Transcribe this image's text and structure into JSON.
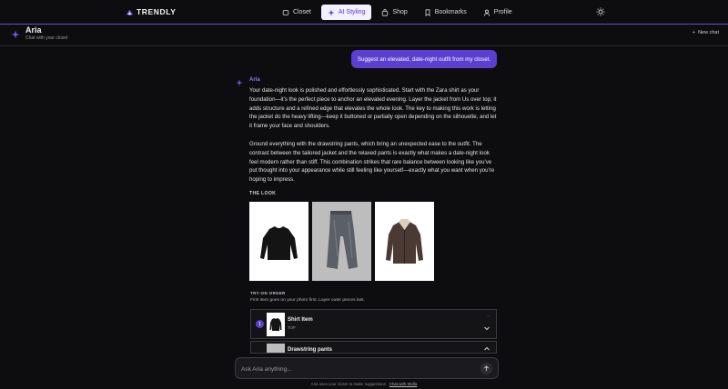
{
  "app": {
    "brand": "TRENDLY"
  },
  "nav": {
    "items": [
      {
        "label": "Closet",
        "icon": "hanger-icon",
        "active": false
      },
      {
        "label": "AI Styling",
        "icon": "sparkle-icon",
        "active": true
      },
      {
        "label": "Shop",
        "icon": "bag-icon",
        "active": false
      },
      {
        "label": "Bookmarks",
        "icon": "bookmark-icon",
        "active": false
      },
      {
        "label": "Profile",
        "icon": "user-icon",
        "active": false
      }
    ]
  },
  "chat": {
    "assistant_name": "Aria",
    "subtitle": "Chat with your closet",
    "new_chat_label": "New chat"
  },
  "messages": {
    "user": "Suggest an elevated, date-night outfit from my closet.",
    "assistant_name": "Aria",
    "paragraph1": "Your date-night look is polished and effortlessly sophisticated. Start with the Zara shirt as your foundation—it's the perfect piece to anchor an elevated evening. Layer the jacket from Us over top; it adds structure and a refined edge that elevates the whole look. The key to making this work is letting the jacket do the heavy lifting—keep it buttoned or partially open depending on the silhouette, and let it frame your face and shoulders.",
    "paragraph2": "Ground everything with the drawstring pants, which bring an unexpected ease to the outfit. The contrast between the tailored jacket and the relaxed pants is exactly what makes a date-night look feel modern rather than stiff. This combination strikes that rare balance between looking like you've put thought into your appearance while still feeling like yourself—exactly what you want when you're hoping to impress.",
    "look_label": "THE LOOK"
  },
  "tryon": {
    "title": "TRY-ON ORDER",
    "subtitle": "First item goes on your photo first. Layer outer pieces last.",
    "items": [
      {
        "index": "1",
        "name": "Shirt Item",
        "category": "TOP"
      },
      {
        "index": "2",
        "name": "Drawstring pants",
        "category": ""
      }
    ]
  },
  "composer": {
    "placeholder": "Ask Aria anything..."
  },
  "footer": {
    "text": "Aria uses your closet to make suggestions · ",
    "link": "Chat with Stella"
  },
  "colors": {
    "accent": "#5b3fd0",
    "background": "#0d0d0f",
    "active_nav_bg": "#f4f1ff"
  }
}
